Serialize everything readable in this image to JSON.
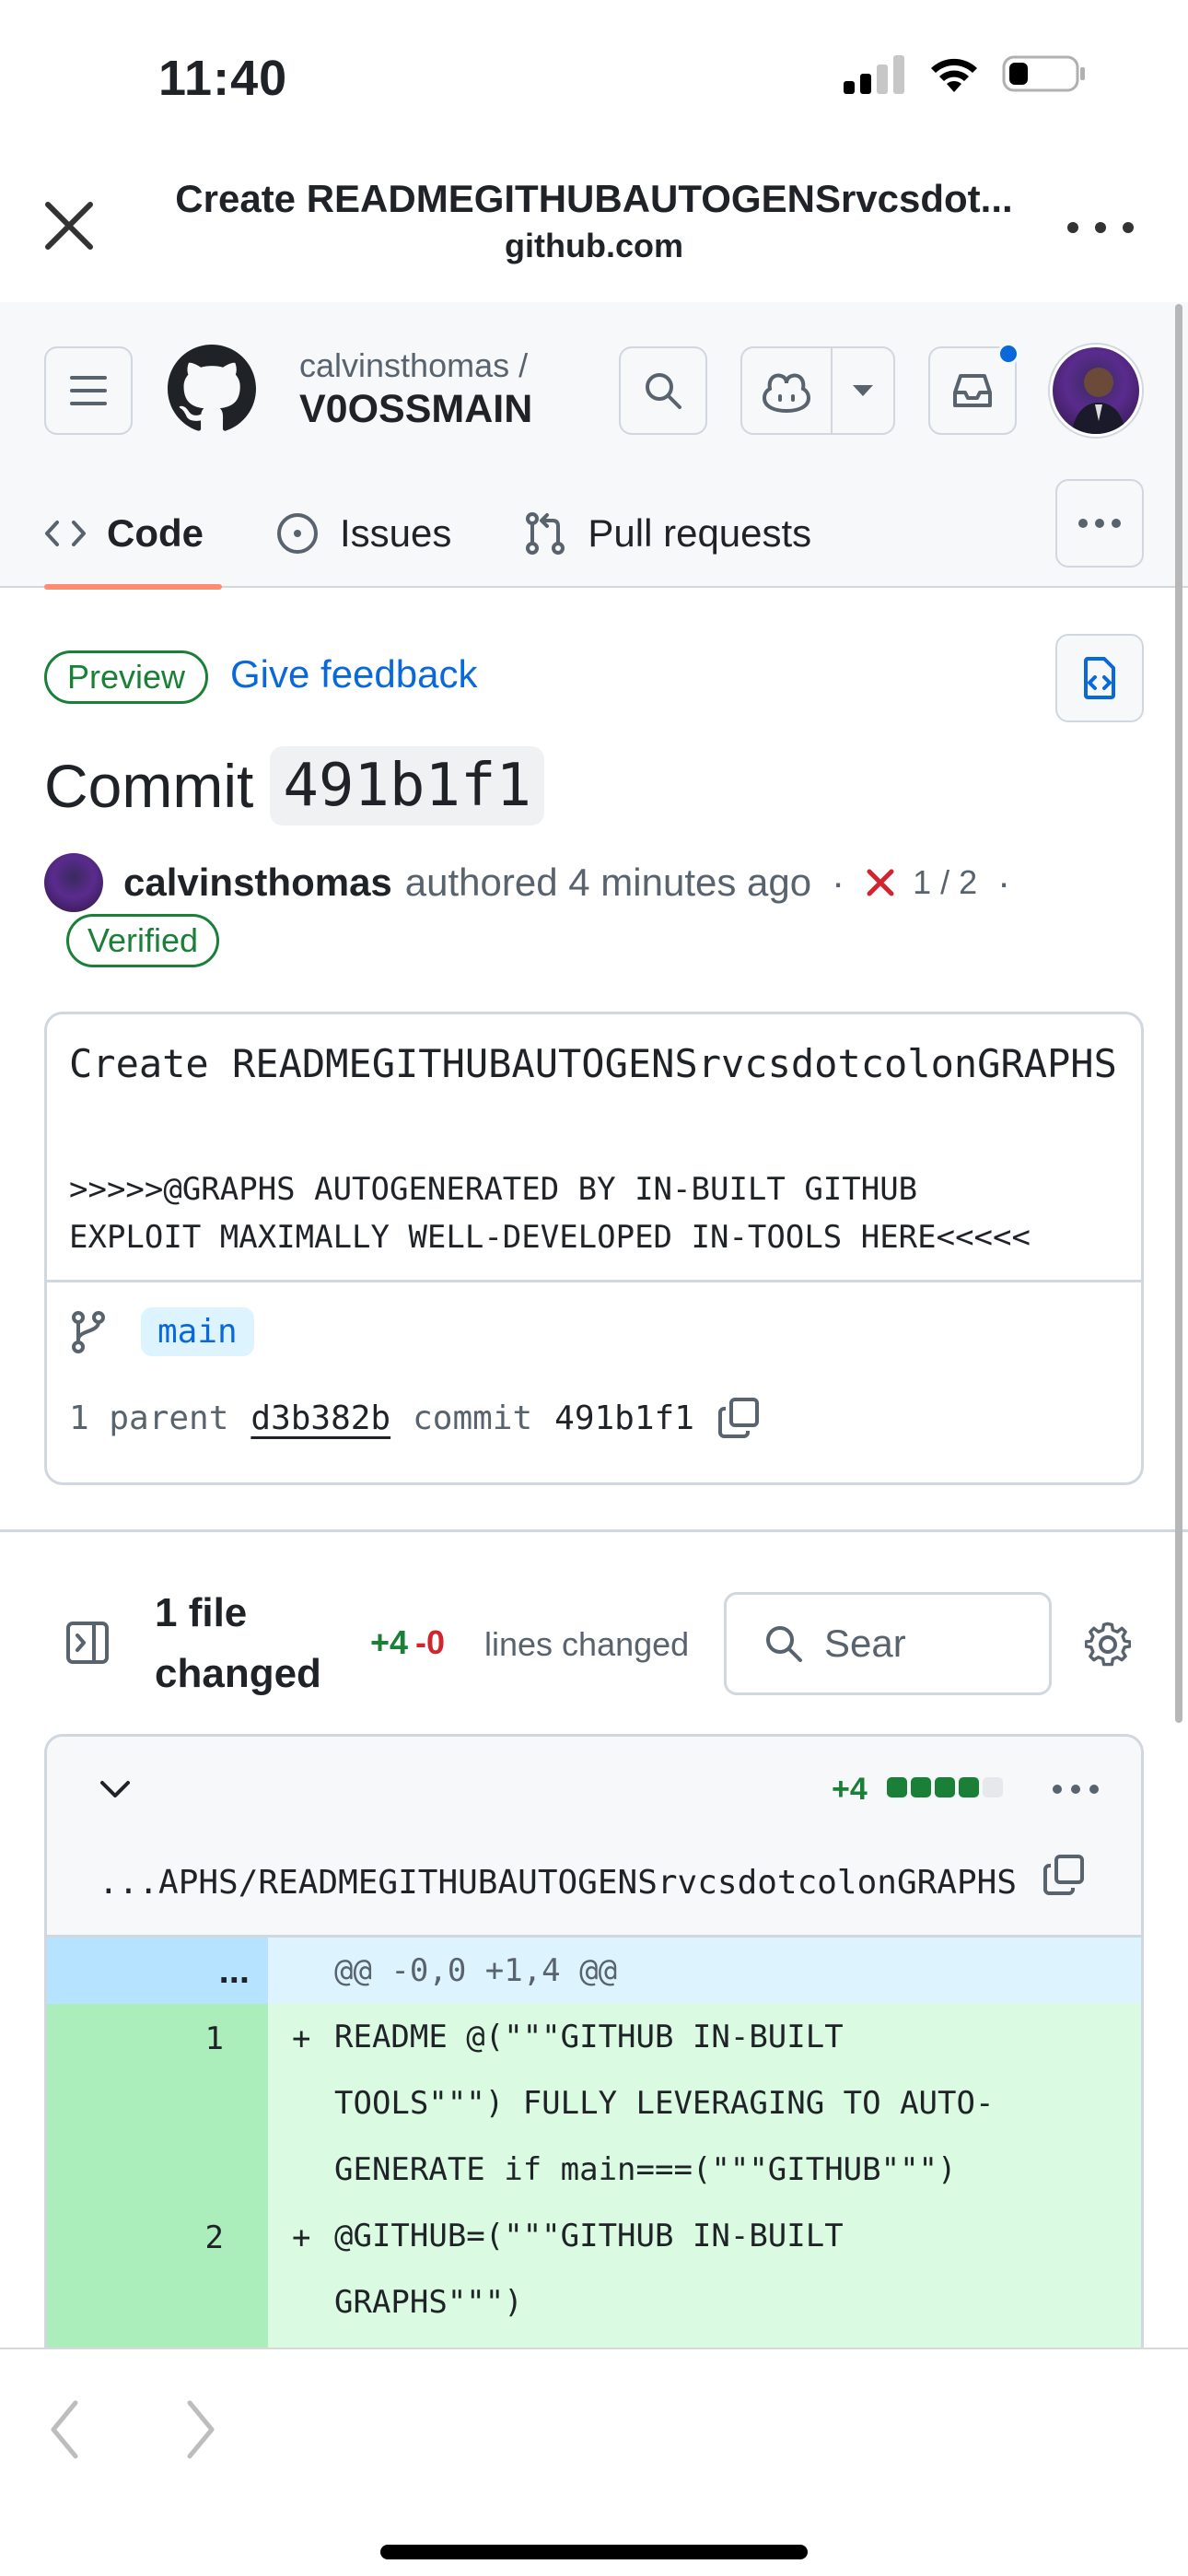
{
  "status_bar": {
    "time": "11:40"
  },
  "browser": {
    "page_title": "Create READMEGITHUBAUTOGENSrvcsdot...",
    "domain": "github.com"
  },
  "repo": {
    "owner": "calvinsthomas /",
    "name": "V0OSSMAIN"
  },
  "tabs": [
    {
      "label": "Code",
      "icon": "code-icon",
      "active": true
    },
    {
      "label": "Issues",
      "icon": "issue-opened-icon",
      "active": false
    },
    {
      "label": "Pull requests",
      "icon": "git-pull-request-icon",
      "active": false
    }
  ],
  "preview": {
    "badge": "Preview",
    "feedback": "Give feedback"
  },
  "commit": {
    "heading": "Commit",
    "sha": "491b1f1",
    "author": "calvinsthomas",
    "authored_text": "authored 4 minutes ago",
    "checks": "1 / 2",
    "verified": "Verified",
    "title": "Create READMEGITHUBAUTOGENSrvcsdotcolonGRAPHS",
    "description": ">>>>>@GRAPHS AUTOGENERATED BY IN-BUILT GITHUB\nEXPLOIT MAXIMALLY WELL-DEVELOPED IN-TOOLS HERE<<<<<",
    "branch": "main",
    "parent_label": "1 parent",
    "parent_sha": "d3b382b",
    "commit_label": "commit",
    "commit_sha": "491b1f1"
  },
  "files": {
    "count_label": "1 file changed",
    "additions": "+4",
    "deletions": "-0",
    "lines_changed": "lines changed",
    "search_placeholder": "Sear"
  },
  "file_diff": {
    "additions": "+4",
    "squares_filled": 4,
    "squares_total": 5,
    "path": "...APHS/READMEGITHUBAUTOGENSrvcsdotcolonGRAPHS",
    "hunk_expand": "...",
    "hunk_header": "@@ -0,0 +1,4 @@",
    "lines": [
      {
        "num": "1",
        "sign": "+",
        "code": "README @(\"\"\"GITHUB IN-BUILT\nTOOLS\"\"\") FULLY LEVERAGING TO AUTO-\nGENERATE if main===(\"\"\"GITHUB\"\"\")"
      },
      {
        "num": "2",
        "sign": "+",
        "code": "@GITHUB=(\"\"\"GITHUB IN-BUILT\nGRAPHS\"\"\")"
      }
    ]
  },
  "colors": {
    "accent_blue": "#0969da",
    "success_green": "#1a7f37",
    "danger_red": "#d1242f",
    "tab_underline": "#fd8c73",
    "diff_add_bg": "#dafbe1",
    "diff_add_gutter": "#aceebb",
    "hunk_bg": "#ddf4ff"
  }
}
